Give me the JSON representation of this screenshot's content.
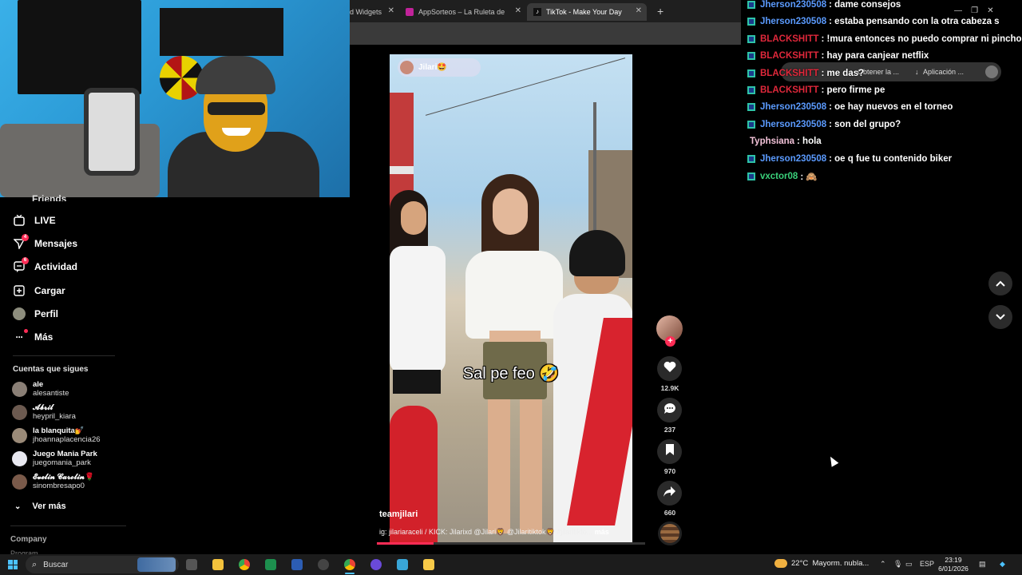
{
  "browser": {
    "tabs": [
      {
        "title": "d Widgets"
      },
      {
        "title": "AppSorteos – La Ruleta de la S..."
      },
      {
        "title": "TikTok - Make Your Day",
        "active": true
      }
    ],
    "new_tab_icon": "plus-icon"
  },
  "nav": {
    "partial_item": "Friends",
    "items": [
      {
        "label": "LIVE",
        "icon": "live-tv-icon"
      },
      {
        "label": "Mensajes",
        "icon": "send-icon",
        "badge": "4"
      },
      {
        "label": "Actividad",
        "icon": "activity-icon",
        "badge": "6"
      },
      {
        "label": "Cargar",
        "icon": "upload-icon"
      },
      {
        "label": "Perfil",
        "icon": "avatar-icon"
      },
      {
        "label": "Más",
        "icon": "more-icon",
        "dot": true
      }
    ]
  },
  "following": {
    "title": "Cuentas que sigues",
    "accounts": [
      {
        "name": "ale",
        "handle": "alesantiste",
        "color": "#8a7f76"
      },
      {
        "name": "𝓐𝓫𝓻𝓲𝓵",
        "handle": "heypril_kiara",
        "color": "#6c5a50"
      },
      {
        "name": "la blanquita💅",
        "handle": "jhoannaplacencia26",
        "color": "#9a8a78"
      },
      {
        "name": "Juego Mania Park",
        "handle": "juegomania_park",
        "color": "#e8e8f0"
      },
      {
        "name": "𝓔𝓿𝓮𝓵𝓲𝓷 𝓒𝓪𝓻𝓸𝓵𝓲𝓷🌹",
        "handle": "sinombresapo0",
        "color": "#7a5a4a"
      }
    ],
    "see_more": "Ver más"
  },
  "footer": {
    "company": "Company",
    "program": "Program"
  },
  "video": {
    "creator_tag": "Jilari🤩",
    "caption": "Sal pe feo 🤣",
    "author": "teamjilari",
    "description": "ig: jilariaraceli / KICK: Jilarixd @Jilari🦁 @Jilaritiktok🦁 #jilaritikto...",
    "more_label": "más",
    "progress": 0.21
  },
  "actions": {
    "likes": "12.9K",
    "comments": "237",
    "saves": "970",
    "shares": "660",
    "follow_plus": "+"
  },
  "chat": [
    {
      "user": "Jherson230508",
      "message": ": dame consejos",
      "color": "#5b9bff"
    },
    {
      "user": "Jherson230508",
      "message": ": estaba pensando con la otra cabeza s",
      "color": "#5b9bff"
    },
    {
      "user": "BLACKSHITT",
      "message": ": !mura entonces no puedo comprar ni pincho",
      "color": "#e0283b"
    },
    {
      "user": "BLACKSHITT",
      "message": ": hay para canjear netflix",
      "color": "#e0283b"
    },
    {
      "user": "BLACKSHITT",
      "message": ": me das?",
      "color": "#e0283b"
    },
    {
      "user": "BLACKSHITT",
      "message": ": pero firme pe",
      "color": "#e0283b"
    },
    {
      "user": "Jherson230508",
      "message": ": oe hay nuevos en el torneo",
      "color": "#5b9bff"
    },
    {
      "user": "Jherson230508",
      "message": ": son del grupo?",
      "color": "#5b9bff"
    },
    {
      "user": "Typhsiana",
      "message": ": hola",
      "color": "#f2c2d8",
      "no_badge": true
    },
    {
      "user": "Jherson230508",
      "message": ": oe q fue tu contenido biker",
      "color": "#5b9bff"
    },
    {
      "user": "vxctor08",
      "message": ": 🙈",
      "color": "#3ad07a"
    }
  ],
  "extension_bar": {
    "item1": "Obtener la ...",
    "item2": "Aplicación ..."
  },
  "taskbar": {
    "search_placeholder": "Buscar",
    "weather_temp": "22°C",
    "weather_text": "Mayorm. nubla...",
    "lang": "ESP",
    "time": "23:19",
    "date": "6/01/2026"
  }
}
